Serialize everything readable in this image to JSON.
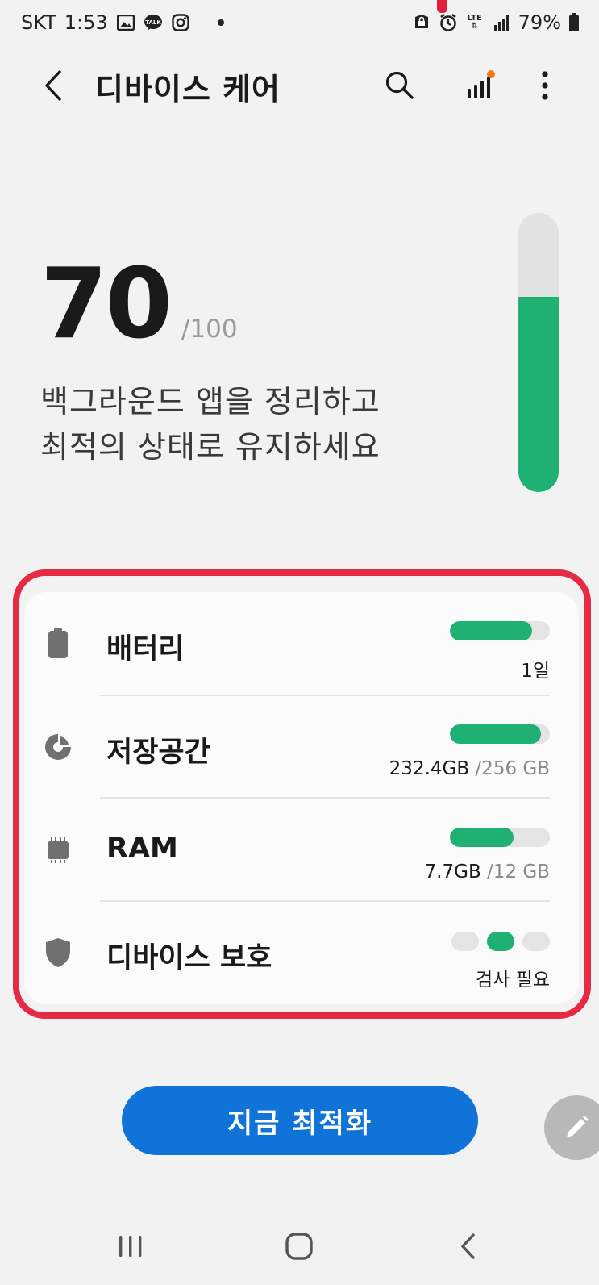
{
  "status_bar": {
    "carrier": "SKT",
    "time": "1:53",
    "left_icons": [
      "gallery-icon",
      "kakaotalk-icon",
      "instagram-icon",
      "dot-icon"
    ],
    "right_icons": [
      "shield-lock-icon",
      "alarm-icon",
      "lte-icon",
      "signal-icon",
      "battery-icon"
    ],
    "lte_label": "LTE",
    "battery": "79%"
  },
  "header": {
    "title": "디바이스 케어",
    "back_icon": "chevron-left-icon",
    "search_icon": "search-icon",
    "stats_icon": "bar-chart-icon",
    "more_icon": "more-vert-icon"
  },
  "score": {
    "value": "70",
    "max": "/100",
    "level": 0.7,
    "message_line1": "백그라운드 앱을 정리하고",
    "message_line2": "최적의 상태로 유지하세요"
  },
  "care_items": [
    {
      "label": "배터리",
      "icon": "battery-icon",
      "value": "1일",
      "total": "",
      "level": 0.82
    },
    {
      "label": "저장공간",
      "icon": "storage-pie-icon",
      "value": "232.4GB",
      "total": " /256 GB",
      "level": 0.91
    },
    {
      "label": "RAM",
      "icon": "chip-icon",
      "value": "7.7GB",
      "total": " /12 GB",
      "level": 0.64
    },
    {
      "label": "디바이스 보호",
      "icon": "shield-icon",
      "value": "검사 필요",
      "total": "",
      "active_dot": 1
    }
  ],
  "optimize_button": {
    "label": "지금 최적화"
  },
  "fab": {
    "icon": "pencil-icon"
  },
  "nav_bar": {
    "recents_icon": "recents-icon",
    "home_icon": "home-icon",
    "back_icon": "back-icon"
  },
  "colors": {
    "accent_green": "#1eb173",
    "button_blue": "#0f73d8",
    "highlight_red": "#e52a44",
    "badge_orange": "#f07a1a"
  }
}
